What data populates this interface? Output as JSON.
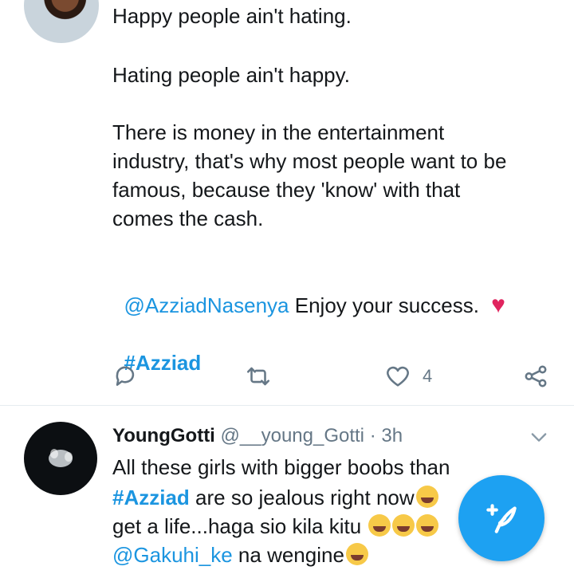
{
  "tweet": {
    "line1": "Happy people ain't hating.",
    "line2": "Hating people ain't happy.",
    "para": "There is money in the entertainment\nindustry, that's why most people want to be\nfamous, because they 'know' with that\ncomes the cash.",
    "mention": "@AzziadNasenya",
    "mention_text": " Enjoy your success. ",
    "heart": "♥",
    "hashtag": "#Azziad",
    "like_count": "4"
  },
  "reply": {
    "name": "YoungGotti",
    "handle": "@__young_Gotti",
    "dot": "·",
    "time": "3h",
    "line1": "All these girls with bigger boobs than",
    "hashtag": "#Azziad",
    "line2_rest": " are so jealous right now",
    "line3": "get a life...haga sio kila kitu ",
    "mention": "@Gakuhi_ke",
    "line4_rest": " na wengine"
  },
  "icons": {
    "reply": "reply-icon",
    "retweet": "retweet-icon",
    "like": "heart-icon",
    "share": "share-icon",
    "menu": "chevron-down-icon",
    "compose": "compose-tweet-icon"
  },
  "colors": {
    "accent": "#1b95e0",
    "heart": "#e0245e",
    "fab": "#1da1f2",
    "muted": "#657786"
  }
}
